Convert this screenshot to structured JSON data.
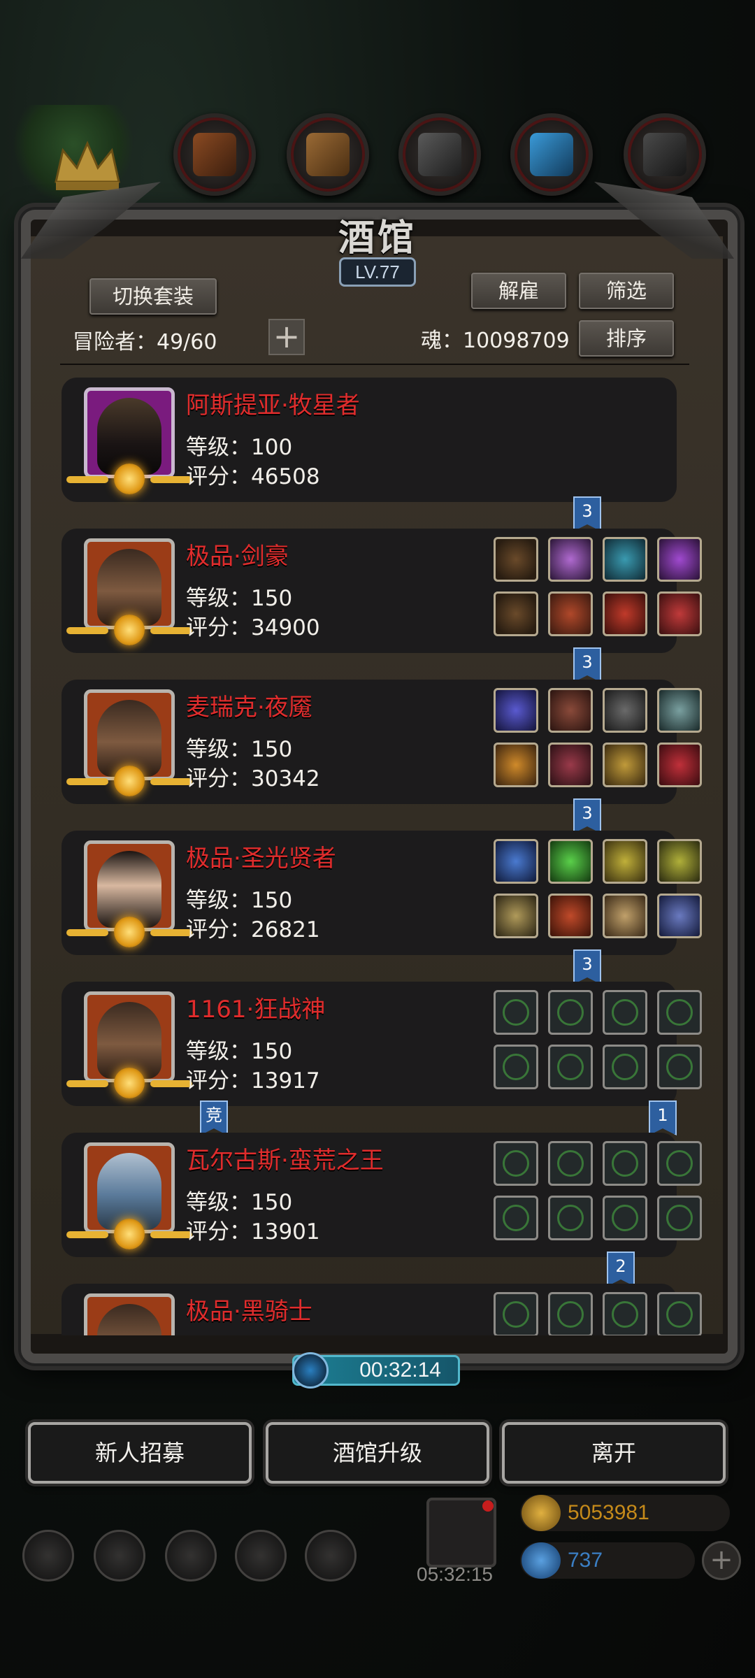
{
  "panel": {
    "title": "酒馆",
    "level": "LV.77",
    "switch_outfit": "切换套装",
    "dismiss": "解雇",
    "filter": "筛选",
    "sort": "排序",
    "adventurers_label": "冒险者：49/60",
    "soul_label": "魂：10098709",
    "add": "+"
  },
  "adventurers": [
    {
      "name": "阿斯提亚·牧星者",
      "level_text": "等级：100",
      "score_text": "评分：46508",
      "frame": "purple",
      "slots": "none"
    },
    {
      "name": "极品·剑豪",
      "level_text": "等级：150",
      "score_text": "评分：34900",
      "frame": "orange",
      "slots": "filled"
    },
    {
      "name": "麦瑞克·夜魇",
      "level_text": "等级：150",
      "score_text": "评分：30342",
      "frame": "orange",
      "slots": "filled"
    },
    {
      "name": "极品·圣光贤者",
      "level_text": "等级：150",
      "score_text": "评分：26821",
      "frame": "orange",
      "slots": "filled"
    },
    {
      "name": "1161·狂战神",
      "level_text": "等级：150",
      "score_text": "评分：13917",
      "frame": "orange",
      "slots": "empty"
    },
    {
      "name": "瓦尔古斯·蛮荒之王",
      "level_text": "等级：150",
      "score_text": "评分：13901",
      "frame": "orange",
      "slots": "empty"
    },
    {
      "name": "极品·黑骑士",
      "level_text": "",
      "score_text": "",
      "frame": "orange",
      "slots": "empty"
    }
  ],
  "bookmarks": [
    "3",
    "3",
    "3",
    "3",
    "竞",
    "1",
    "2"
  ],
  "timer": "00:32:14",
  "actions": {
    "recruit": "新人招募",
    "upgrade": "酒馆升级",
    "leave": "离开"
  },
  "bottom": {
    "gift_timer": "05:32:15",
    "gold": "5053981",
    "gems": "737",
    "add": "+"
  },
  "colors": {
    "name_red": "#e02c2c",
    "timer_teal": "#1d7f94",
    "gold_text": "#c58a1a",
    "gem_text": "#3b7fc4"
  }
}
